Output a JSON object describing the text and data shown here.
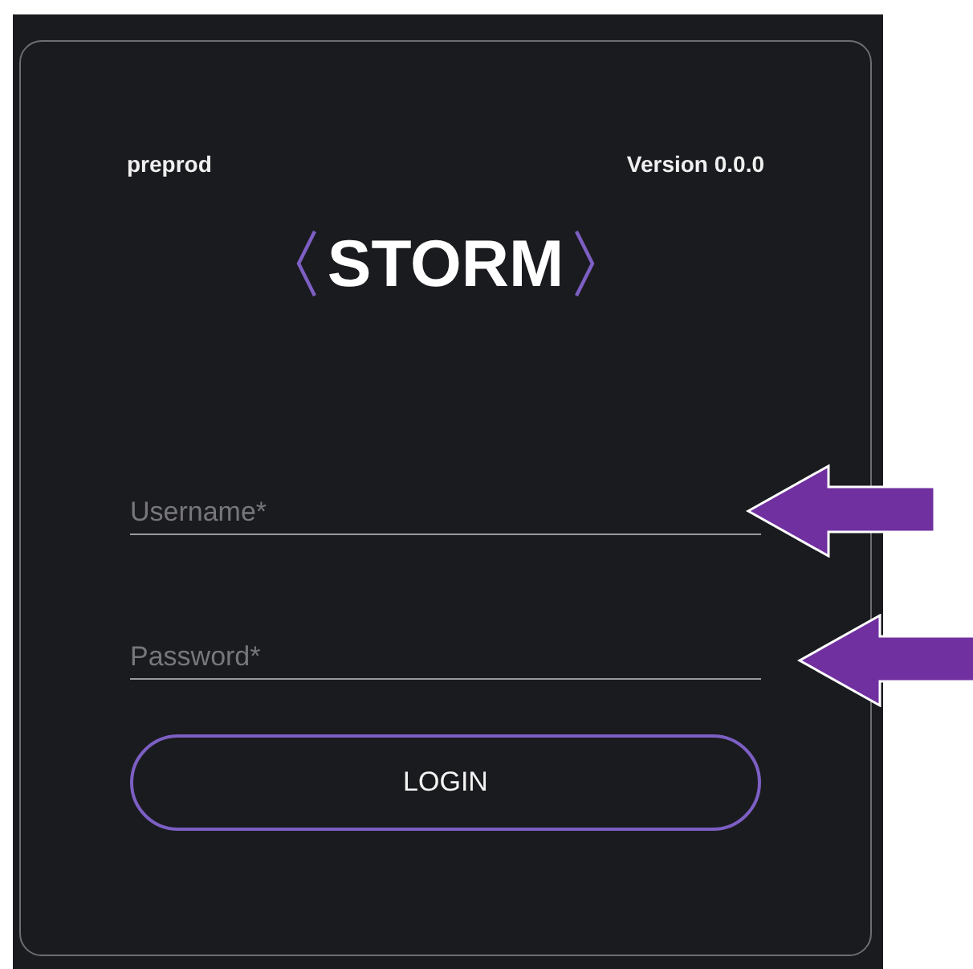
{
  "header": {
    "environment": "preprod",
    "version": "Version 0.0.0"
  },
  "logo": {
    "text": "STORM"
  },
  "username": {
    "placeholder": "Username*"
  },
  "password": {
    "placeholder": "Password*"
  },
  "button": {
    "label": "LOGIN"
  },
  "annotations": [
    {
      "kind": "arrow"
    },
    {
      "kind": "arrow"
    }
  ]
}
